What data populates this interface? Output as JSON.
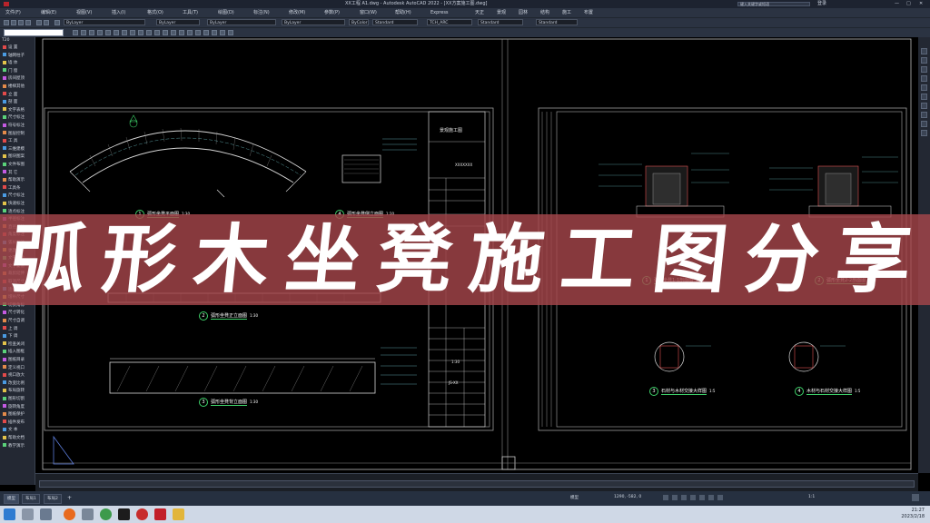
{
  "window": {
    "title": "XX工程 A1.dwg - Autodesk AutoCAD 2022 - [XX方案施工图.dwg]",
    "search_placeholder": "键入关键字或短语",
    "user": "登录"
  },
  "menubar": [
    "文件(F)",
    "编辑(E)",
    "视图(V)",
    "插入(I)",
    "格式(O)",
    "工具(T)",
    "绘图(D)",
    "标注(N)",
    "修改(M)",
    "参数(P)",
    "窗口(W)",
    "帮助(H)",
    "Express",
    "天正",
    "景观",
    "园林",
    "结构",
    "施工",
    "布置"
  ],
  "toolbar": {
    "layer_value": "ByLayer",
    "linetype_value": "ByLayer",
    "lineweight_value": "ByLayer",
    "color_value": "ByColor",
    "textstyle_value": "Standard",
    "dimstyle_value": "TCH_ARC",
    "tablestyle_value": "Standard",
    "mleaderstyle_value": "Standard"
  },
  "sidepanel": {
    "items": [
      "设 置",
      "轴网柱子",
      "墙 体",
      "门 窗",
      "房间屋顶",
      "楼梯其他",
      "立 面",
      "剖 面",
      "文字表格",
      "尺寸标注",
      "符号标注",
      "图层控制",
      "工 具",
      "三维建模",
      "图块图案",
      "文件布图",
      "其 它",
      "帮助演示",
      "工具条",
      "尺寸标注",
      "快速标注",
      "逐点标注",
      "半径标注",
      "直径标注",
      "角度标注",
      "弧长标注",
      "更改文字",
      "文字复位",
      "文字复值",
      "裁剪延伸",
      "取消尺寸",
      "连接尺寸",
      "增补尺寸",
      "切换角标",
      "尺寸转化",
      "尺寸自调",
      "上 调",
      "下 调",
      "检查关闭",
      "插入图框",
      "图纸目录",
      "定义视口",
      "视口放大",
      "改变比例",
      "布局旋转",
      "图形切割",
      "旋转角度",
      "图纸保护",
      "插件发布",
      "文 本",
      "帮助文档",
      "教学演示"
    ]
  },
  "drawing": {
    "left_sheet": {
      "title_block_heading": "景观施工图",
      "project_value": "XXXXXXX",
      "scale_value": "1:30",
      "sheet_no": "JS-XX",
      "views": [
        {
          "label": "弧形坐凳平面图",
          "scale": "1:30",
          "num": "1"
        },
        {
          "label": "弧形坐凳侧立面图",
          "scale": "1:20",
          "num": "4"
        },
        {
          "label": "弧形坐凳正立面图",
          "scale": "1:30",
          "num": "2"
        },
        {
          "label": "弧形坐凳背立面图",
          "scale": "1:30",
          "num": "3"
        }
      ]
    },
    "right_sheet": {
      "views": [
        {
          "label": "弧形坐凳1-1剖面图",
          "scale": "1:10",
          "num": "1"
        },
        {
          "label": "弧形坐凳2-2剖面图",
          "scale": "1:10",
          "num": "2"
        },
        {
          "label": "石材与木材交接大样图",
          "scale": "1:5",
          "num": "3"
        },
        {
          "label": "木材与石材交接大样图",
          "scale": "1:5",
          "num": "4"
        }
      ]
    }
  },
  "banner": {
    "text": [
      "弧",
      "形",
      "木",
      "坐",
      "凳",
      "施",
      "工",
      "图",
      "分",
      "享"
    ],
    "color": "#a6464b"
  },
  "status": {
    "tabs": [
      "模型",
      "布局1",
      "布局2"
    ],
    "coords": "1290, -582, 0",
    "model_label": "模型",
    "scale_label": "1:1"
  },
  "taskbar": {
    "time": "21:27",
    "date": "2023/2/18"
  }
}
